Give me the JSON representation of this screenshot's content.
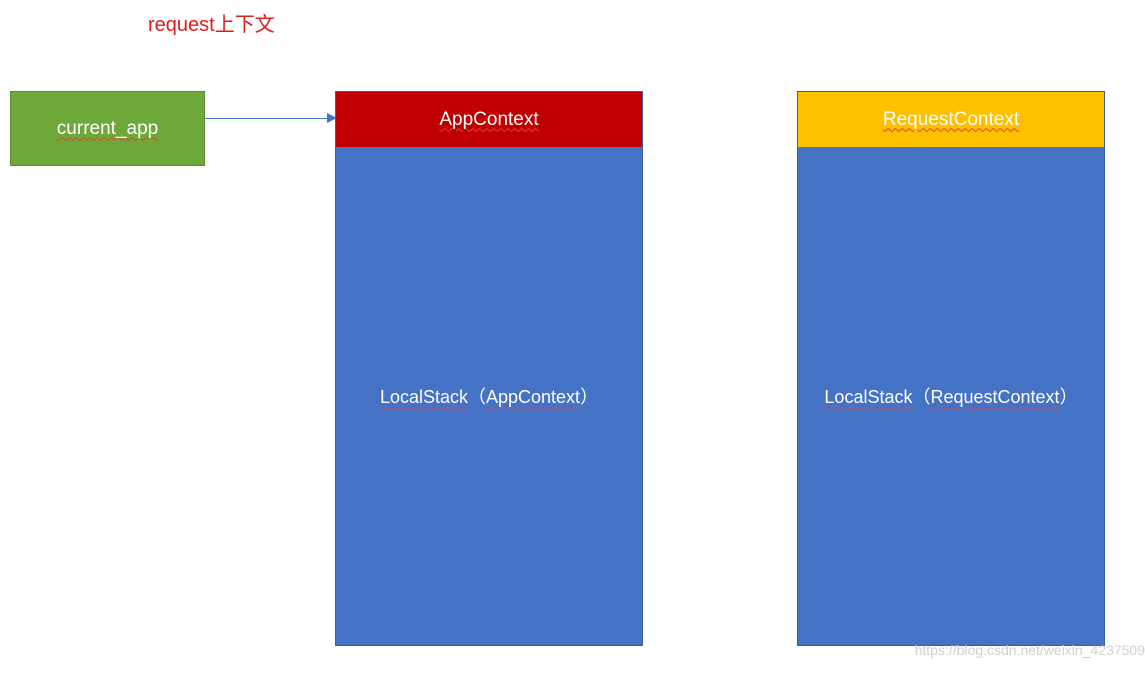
{
  "title": "request上下文",
  "current_app": {
    "label": "current_app"
  },
  "stacks": {
    "left": {
      "header": "AppContext",
      "body_prefix": "LocalStack",
      "body_param": "AppContext"
    },
    "right": {
      "header": "RequestContext",
      "body_prefix": "LocalStack",
      "body_param": "RequestContext"
    }
  },
  "watermark": "https://blog.csdn.net/weixin_4237509",
  "colors": {
    "title_color": "#d92020",
    "current_app_bg": "#6ea838",
    "header_red": "#c00000",
    "header_orange": "#ffc000",
    "body_blue": "#4472c4",
    "arrow": "#4472c4"
  }
}
